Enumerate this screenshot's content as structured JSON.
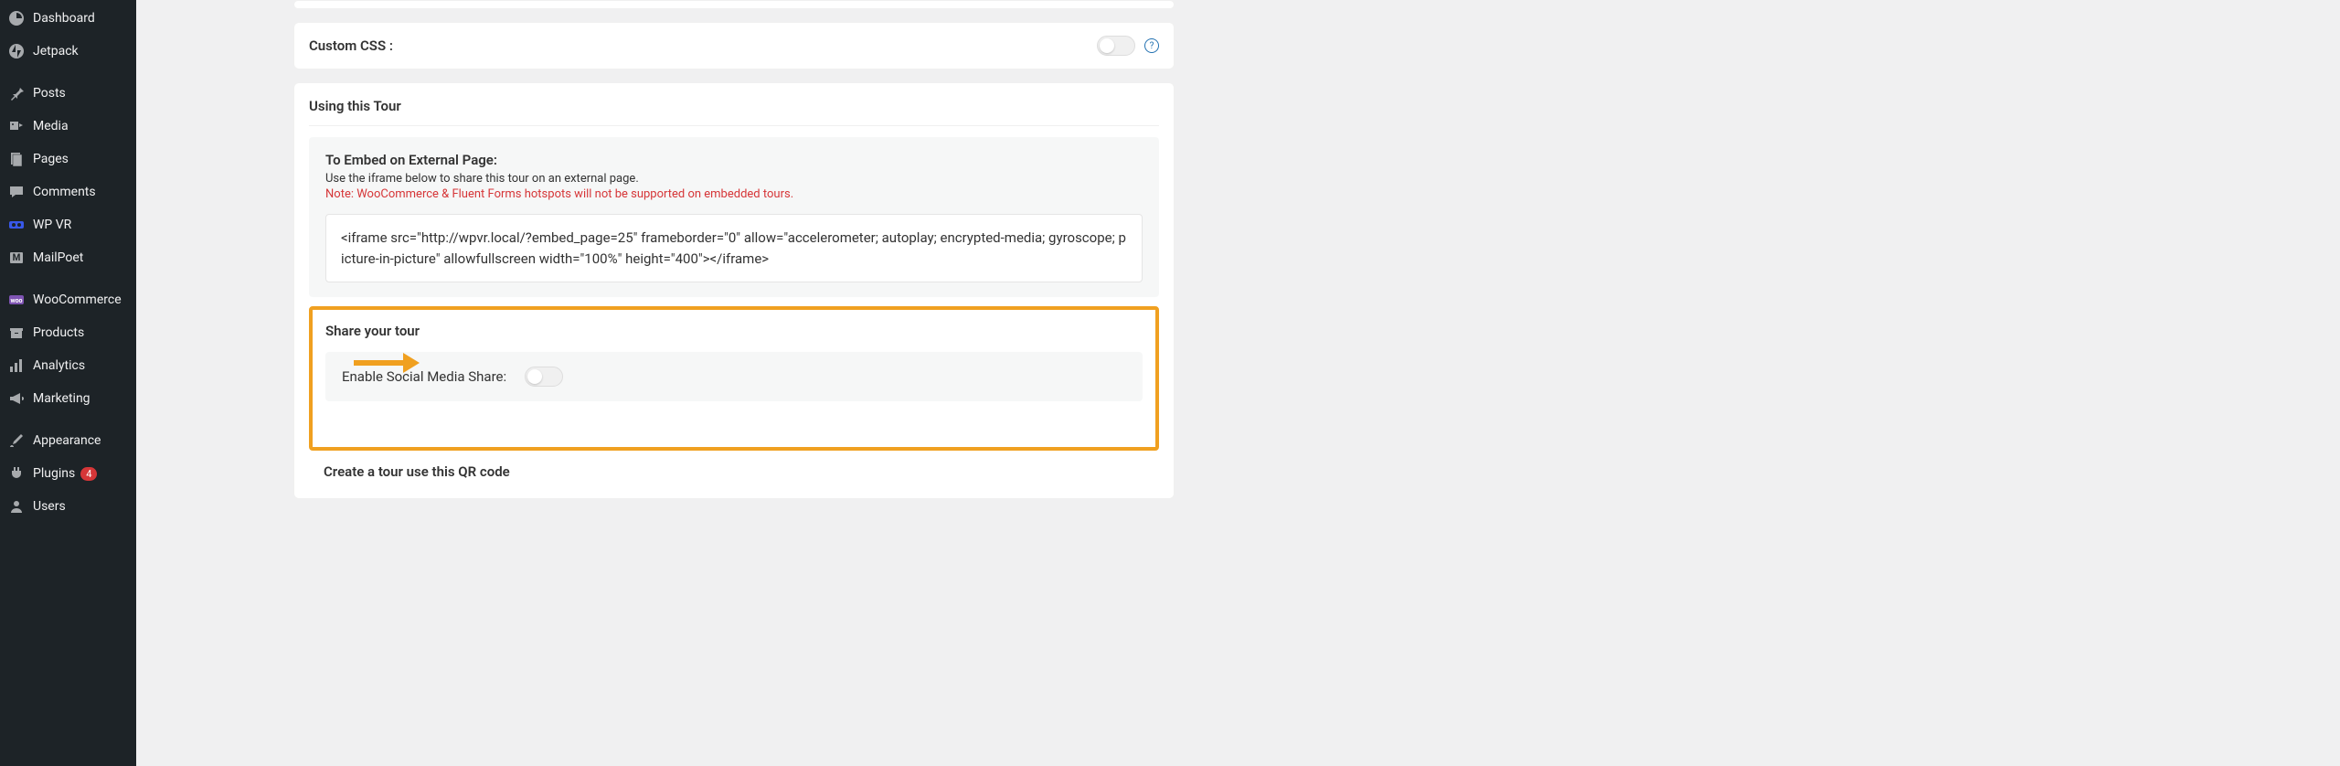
{
  "sidebar": {
    "items": [
      {
        "label": "Dashboard",
        "icon": "dashboard"
      },
      {
        "label": "Jetpack",
        "icon": "jetpack"
      },
      {
        "label": "Posts",
        "icon": "pin"
      },
      {
        "label": "Media",
        "icon": "media"
      },
      {
        "label": "Pages",
        "icon": "pages"
      },
      {
        "label": "Comments",
        "icon": "comment"
      },
      {
        "label": "WP VR",
        "icon": "vr"
      },
      {
        "label": "MailPoet",
        "icon": "mail"
      },
      {
        "label": "WooCommerce",
        "icon": "woo"
      },
      {
        "label": "Products",
        "icon": "archive"
      },
      {
        "label": "Analytics",
        "icon": "chart"
      },
      {
        "label": "Marketing",
        "icon": "megaphone"
      },
      {
        "label": "Appearance",
        "icon": "brush"
      },
      {
        "label": "Plugins",
        "icon": "plugin",
        "badge": "4"
      },
      {
        "label": "Users",
        "icon": "user"
      }
    ]
  },
  "custom_css": {
    "label": "Custom CSS :"
  },
  "using_tour": {
    "header": "Using this Tour"
  },
  "embed": {
    "title": "To Embed on External Page:",
    "desc": "Use the iframe below to share this tour on an external page.",
    "note": "Note: WooCommerce & Fluent Forms hotspots will not be supported on embedded tours.",
    "code": "<iframe src=\"http://wpvr.local/?embed_page=25\" frameborder=\"0\" allow=\"accelerometer; autoplay; encrypted-media; gyroscope; picture-in-picture\" allowfullscreen width=\"100%\" height=\"400\"></iframe>"
  },
  "share": {
    "header": "Share your tour",
    "enable_label": "Enable Social Media Share:"
  },
  "qr": {
    "title": "Create a tour use this QR code"
  }
}
